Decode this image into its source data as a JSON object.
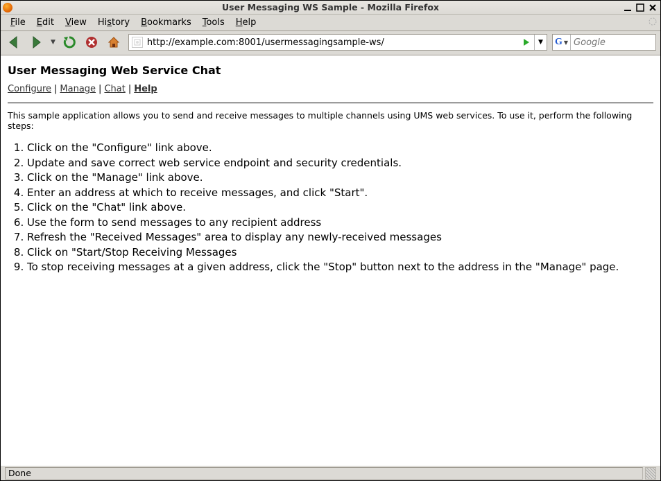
{
  "window": {
    "title": "User Messaging WS Sample - Mozilla Firefox"
  },
  "win_controls": {
    "minimize": "_",
    "maximize": "▫",
    "close": "✕"
  },
  "menubar": {
    "file": "File",
    "edit": "Edit",
    "view": "View",
    "history": "History",
    "bookmarks": "Bookmarks",
    "tools": "Tools",
    "help": "Help"
  },
  "toolbar": {
    "url": "http://example.com:8001/usermessagingsample-ws/",
    "search_placeholder": "Google",
    "dropdown_arrow": "▼",
    "go_arrow": "▶"
  },
  "page": {
    "heading": "User Messaging Web Service Chat",
    "nav": {
      "configure": "Configure",
      "manage": "Manage",
      "chat": "Chat",
      "help": "Help",
      "sep": "|"
    },
    "intro": "This sample application allows you to send and receive messages to multiple channels using UMS web services. To use it, perform the following steps:",
    "steps": [
      "Click on the \"Configure\" link above.",
      "Update and save correct web service endpoint and security credentials.",
      "Click on the \"Manage\" link above.",
      "Enter an address at which to receive messages, and click \"Start\".",
      "Click on the \"Chat\" link above.",
      "Use the form to send messages to any recipient address",
      "Refresh the \"Received Messages\" area to display any newly-received messages",
      "Click on \"Start/Stop Receiving Messages",
      "To stop receiving messages at a given address, click the \"Stop\" button next to the address in the \"Manage\" page."
    ]
  },
  "status": {
    "text": "Done"
  }
}
